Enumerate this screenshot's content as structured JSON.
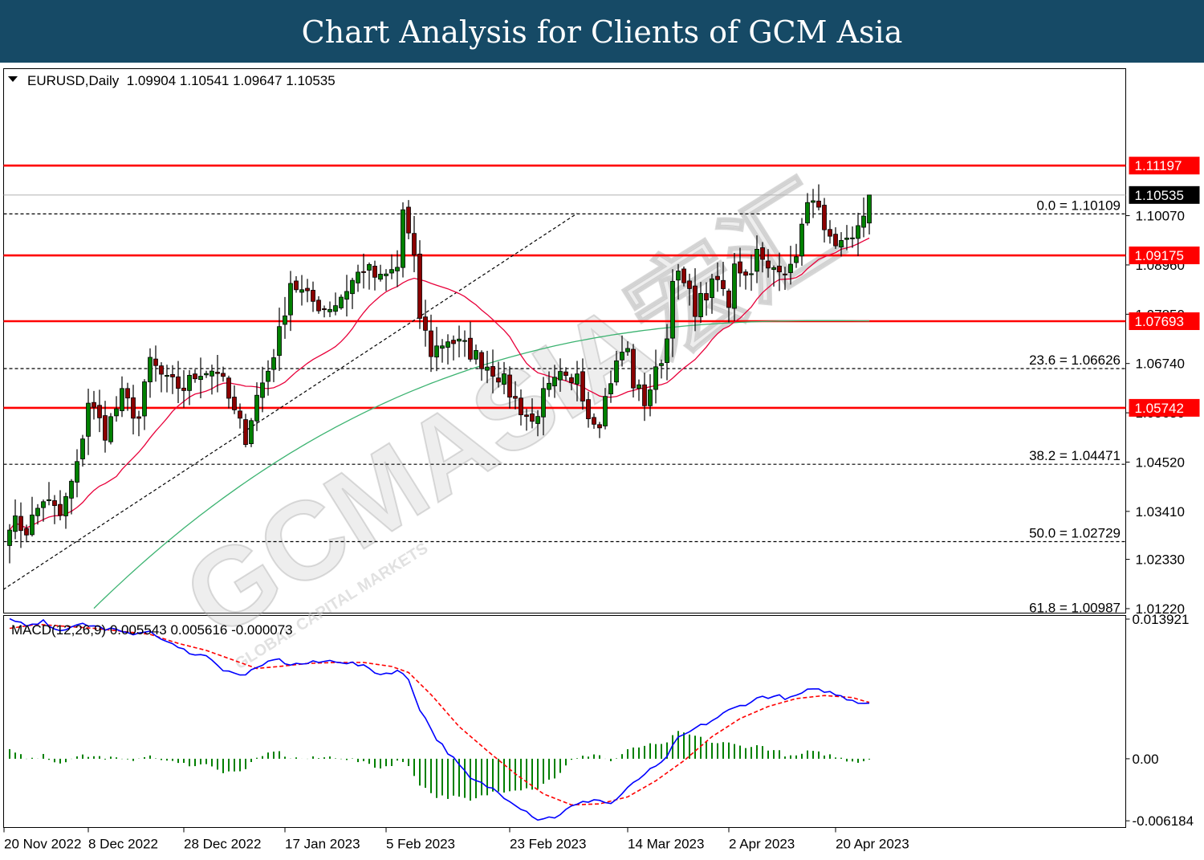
{
  "banner": {
    "title": "Chart Analysis for Clients of GCM Asia"
  },
  "colors": {
    "banner": "#164a66",
    "bull": "#008000",
    "bear": "#8b0000",
    "resistance": "#ff0000",
    "ma_fast": "#e8003a",
    "ma_slow": "#3cb371",
    "macd": "#0000ff",
    "signal": "#ff0000",
    "histogram": "#008000",
    "current_price_bg": "#000000",
    "watermark": "#cfcfcf"
  },
  "watermark": {
    "main": "GCMASIA宏汇",
    "sub": "GLOBAL CAPITAL MARKETS"
  },
  "chart_data": [
    {
      "type": "candlestick",
      "header": "EURUSD,Daily  1.09904 1.10541 1.09647 1.10535",
      "symbol": "EURUSD",
      "timeframe": "Daily",
      "ohlc_current": [
        1.09904,
        1.10541,
        1.09647,
        1.10535
      ],
      "ylim": [
        1.0112,
        1.1338
      ],
      "y_ticks": [
        "1.10070",
        "1.08960",
        "1.07850",
        "1.06740",
        "1.05630",
        "1.04520",
        "1.03410",
        "1.02330",
        "1.01220"
      ],
      "x_ticks": [
        "20 Nov 2022",
        "8 Dec 2022",
        "28 Dec 2022",
        "17 Jan 2023",
        "5 Feb 2023",
        "23 Feb 2023",
        "14 Mar 2023",
        "2 Apr 2023",
        "20 Apr 2023"
      ],
      "x_tick_index": [
        0,
        15,
        32,
        50,
        68,
        90,
        111,
        129,
        148
      ],
      "resistance_levels": [
        {
          "label": "1.11197",
          "value": 1.11197
        },
        {
          "label": "1.09175",
          "value": 1.09175
        },
        {
          "label": "1.07693",
          "value": 1.07693
        },
        {
          "label": "1.05742",
          "value": 1.05742
        }
      ],
      "current_price": {
        "label": "1.10535",
        "value": 1.10535
      },
      "fibonacci": [
        {
          "label": "0.0 = 1.10109",
          "value": 1.10109
        },
        {
          "label": "23.6 = 1.06626",
          "value": 1.06626
        },
        {
          "label": "38.2 = 1.04471",
          "value": 1.04471
        },
        {
          "label": "50.0 = 1.02729",
          "value": 1.02729
        },
        {
          "label": "61.8 = 1.00987",
          "value": 1.00987
        }
      ],
      "trendline": {
        "from": [
          0,
          1.0165
        ],
        "to": [
          101,
          1.1012
        ]
      },
      "anchors": [
        [
          0,
          1.032
        ],
        [
          3,
          1.03
        ],
        [
          6,
          1.037
        ],
        [
          9,
          1.033
        ],
        [
          12,
          1.044
        ],
        [
          14,
          1.059
        ],
        [
          17,
          1.052
        ],
        [
          20,
          1.06
        ],
        [
          23,
          1.055
        ],
        [
          25,
          1.068
        ],
        [
          28,
          1.063
        ],
        [
          31,
          1.062
        ],
        [
          34,
          1.066
        ],
        [
          37,
          1.066
        ],
        [
          40,
          1.056
        ],
        [
          42,
          1.051
        ],
        [
          44,
          1.06
        ],
        [
          46,
          1.066
        ],
        [
          48,
          1.074
        ],
        [
          50,
          1.086
        ],
        [
          53,
          1.082
        ],
        [
          56,
          1.08
        ],
        [
          58,
          1.081
        ],
        [
          61,
          1.086
        ],
        [
          63,
          1.089
        ],
        [
          66,
          1.086
        ],
        [
          69,
          1.089
        ],
        [
          70,
          1.102
        ],
        [
          72,
          1.09
        ],
        [
          73,
          1.078
        ],
        [
          75,
          1.07
        ],
        [
          78,
          1.073
        ],
        [
          81,
          1.071
        ],
        [
          84,
          1.068
        ],
        [
          87,
          1.065
        ],
        [
          90,
          1.059
        ],
        [
          93,
          1.054
        ],
        [
          95,
          1.06
        ],
        [
          98,
          1.064
        ],
        [
          100,
          1.062
        ],
        [
          101,
          1.066
        ],
        [
          103,
          1.056
        ],
        [
          105,
          1.055
        ],
        [
          107,
          1.064
        ],
        [
          109,
          1.07
        ],
        [
          110,
          1.07
        ],
        [
          111,
          1.063
        ],
        [
          113,
          1.059
        ],
        [
          115,
          1.065
        ],
        [
          117,
          1.073
        ],
        [
          118,
          1.088
        ],
        [
          120,
          1.085
        ],
        [
          122,
          1.08
        ],
        [
          124,
          1.083
        ],
        [
          126,
          1.086
        ],
        [
          128,
          1.081
        ],
        [
          129,
          1.091
        ],
        [
          131,
          1.087
        ],
        [
          133,
          1.092
        ],
        [
          135,
          1.088
        ],
        [
          137,
          1.09
        ],
        [
          139,
          1.088
        ],
        [
          141,
          1.098
        ],
        [
          143,
          1.106
        ],
        [
          145,
          1.096
        ],
        [
          147,
          1.092
        ],
        [
          149,
          1.096
        ],
        [
          151,
          1.0975
        ],
        [
          152,
          1.099
        ],
        [
          153,
          1.1053
        ]
      ]
    },
    {
      "type": "macd",
      "header": "MACD(12,26,9) 0.005543 0.005616 -0.000073",
      "params": "12,26,9",
      "values": [
        0.005543,
        0.005616,
        -7.3e-05
      ],
      "ylim": [
        -0.00685,
        0.01428
      ],
      "y_ticks": [
        "0.013921",
        "0.00",
        "-0.006184"
      ],
      "macd_anchors": [
        [
          0,
          0.0139
        ],
        [
          3,
          0.0134
        ],
        [
          6,
          0.0137
        ],
        [
          9,
          0.0127
        ],
        [
          12,
          0.0135
        ],
        [
          15,
          0.0132
        ],
        [
          18,
          0.0129
        ],
        [
          21,
          0.0124
        ],
        [
          24,
          0.0128
        ],
        [
          27,
          0.012
        ],
        [
          30,
          0.011
        ],
        [
          33,
          0.0105
        ],
        [
          36,
          0.01
        ],
        [
          38,
          0.0088
        ],
        [
          41,
          0.0083
        ],
        [
          44,
          0.0089
        ],
        [
          47,
          0.01
        ],
        [
          50,
          0.0094
        ],
        [
          53,
          0.0095
        ],
        [
          58,
          0.0098
        ],
        [
          61,
          0.0095
        ],
        [
          64,
          0.009
        ],
        [
          66,
          0.0084
        ],
        [
          69,
          0.0088
        ],
        [
          71,
          0.0079
        ],
        [
          73,
          0.005
        ],
        [
          76,
          0.002
        ],
        [
          79,
          0.0
        ],
        [
          82,
          -0.002
        ],
        [
          86,
          -0.003
        ],
        [
          90,
          -0.0045
        ],
        [
          94,
          -0.006
        ],
        [
          97,
          -0.0058
        ],
        [
          100,
          -0.0048
        ],
        [
          104,
          -0.004
        ],
        [
          107,
          -0.0045
        ],
        [
          110,
          -0.003
        ],
        [
          113,
          -0.0015
        ],
        [
          116,
          -0.0005
        ],
        [
          119,
          0.002
        ],
        [
          122,
          0.003
        ],
        [
          125,
          0.0038
        ],
        [
          128,
          0.0048
        ],
        [
          131,
          0.0055
        ],
        [
          134,
          0.0062
        ],
        [
          137,
          0.0062
        ],
        [
          139,
          0.006
        ],
        [
          142,
          0.0068
        ],
        [
          145,
          0.0068
        ],
        [
          148,
          0.0062
        ],
        [
          151,
          0.0057
        ],
        [
          153,
          0.0055
        ]
      ],
      "signal_anchors": [
        [
          0,
          0.013
        ],
        [
          5,
          0.0134
        ],
        [
          10,
          0.0132
        ],
        [
          15,
          0.013
        ],
        [
          20,
          0.0127
        ],
        [
          25,
          0.0124
        ],
        [
          30,
          0.0115
        ],
        [
          35,
          0.0108
        ],
        [
          40,
          0.0098
        ],
        [
          44,
          0.009
        ],
        [
          48,
          0.0092
        ],
        [
          53,
          0.0095
        ],
        [
          58,
          0.0096
        ],
        [
          63,
          0.0096
        ],
        [
          68,
          0.0092
        ],
        [
          71,
          0.0086
        ],
        [
          75,
          0.0064
        ],
        [
          80,
          0.0032
        ],
        [
          85,
          0.0008
        ],
        [
          90,
          -0.0015
        ],
        [
          95,
          -0.0035
        ],
        [
          100,
          -0.0046
        ],
        [
          105,
          -0.0045
        ],
        [
          110,
          -0.0038
        ],
        [
          115,
          -0.0022
        ],
        [
          120,
          -0.0002
        ],
        [
          125,
          0.0022
        ],
        [
          130,
          0.004
        ],
        [
          135,
          0.0052
        ],
        [
          140,
          0.006
        ],
        [
          145,
          0.0063
        ],
        [
          150,
          0.0061
        ],
        [
          153,
          0.0056
        ]
      ]
    }
  ]
}
